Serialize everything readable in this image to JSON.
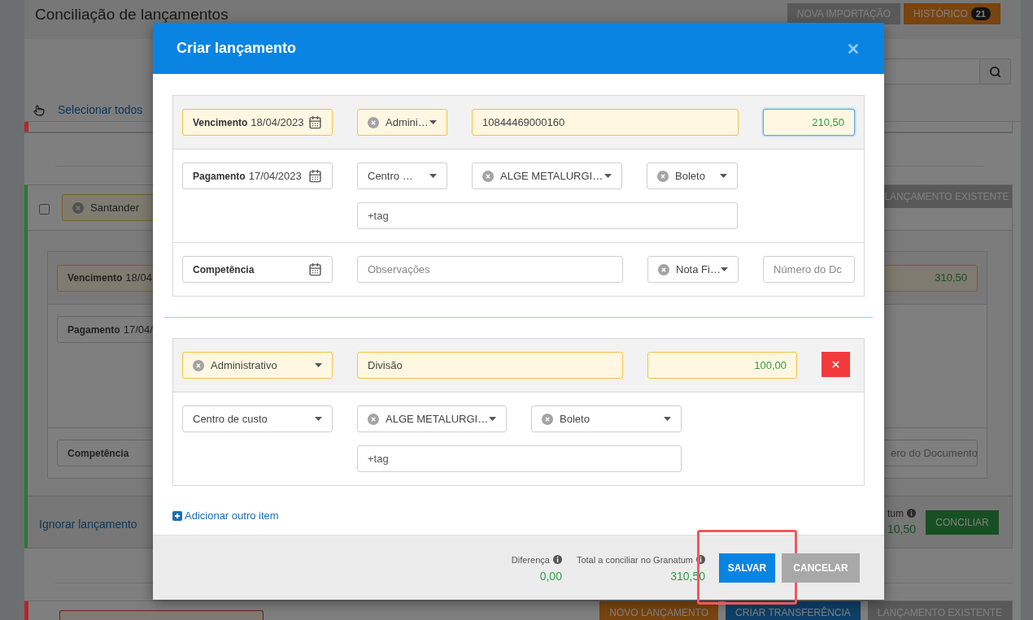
{
  "page": {
    "title": "Conciliação de lançamentos",
    "header_buttons": [
      {
        "label": "NOVA IMPORTAÇÃO",
        "kind": "plain"
      },
      {
        "label": "HISTÓRICO",
        "badge": "21",
        "kind": "accent"
      }
    ],
    "select_all": "Selecionar todos"
  },
  "entry_above": {
    "color": "#b3262a"
  },
  "entry": {
    "color": "#237a35",
    "checked": false,
    "account": "Santander",
    "action": "LANÇAMENTO EXISTENTE",
    "due": {
      "label": "Vencimento",
      "value": "18/04"
    },
    "amount": "310,50",
    "payment": {
      "label": "Pagamento",
      "value": "17/04/"
    },
    "competence": {
      "label": "Competência"
    },
    "document_placeholder": "ero do Documento",
    "ignore": "Ignorar lançamento",
    "total_label": "tum",
    "total_value": "10,50",
    "reconcile": "CONCILIAR"
  },
  "entry_below": {
    "color": "#b3262a",
    "buttons": [
      {
        "label": "NOVO LANÇAMENTO",
        "kind": "orange"
      },
      {
        "label": "CRIAR TRANSFERÊNCIA",
        "kind": "blue"
      },
      {
        "label": "LANÇAMENTO EXISTENTE",
        "kind": "gray"
      }
    ]
  },
  "dialog": {
    "title": "Criar lançamento",
    "sections": [
      {
        "rows": [
          {
            "fields": [
              {
                "kind": "date",
                "label": "Vencimento",
                "value": "18/04/2023",
                "highlighted": true
              },
              {
                "kind": "select",
                "value": "Admini…",
                "clearable": true,
                "highlighted": true
              },
              {
                "kind": "text",
                "value": "10844469000160",
                "highlighted": true
              },
              {
                "kind": "amount",
                "value": "210,50",
                "highlighted": true,
                "focused": true
              }
            ]
          },
          {
            "fields": [
              {
                "kind": "date",
                "label": "Pagamento",
                "value": "17/04/2023",
                "highlighted": false
              },
              {
                "kind": "select",
                "value": "Centro …",
                "clearable": false,
                "highlighted": false
              },
              {
                "kind": "select",
                "value": "ALGE METALURGI…",
                "clearable": true,
                "highlighted": false
              },
              {
                "kind": "select",
                "value": "Boleto",
                "clearable": true,
                "highlighted": false
              }
            ],
            "tag": {
              "placeholder": "+tag"
            }
          },
          {
            "fields": [
              {
                "kind": "date",
                "label": "Competência",
                "highlighted": false
              },
              {
                "kind": "text",
                "placeholder": "Observações",
                "highlighted": false
              },
              {
                "kind": "select",
                "value": "Nota Fi…",
                "clearable": true,
                "highlighted": false
              },
              {
                "kind": "text",
                "placeholder": "Número do Dc",
                "highlighted": false
              }
            ]
          }
        ]
      },
      {
        "rows": [
          {
            "fields": [
              {
                "kind": "select",
                "value": "Administrativo",
                "clearable": true,
                "highlighted": true
              },
              {
                "kind": "text",
                "value": "Divisão",
                "highlighted": true
              },
              {
                "kind": "amount",
                "value": "100,00",
                "highlighted": true,
                "focused": false
              },
              {
                "kind": "remove"
              }
            ]
          },
          {
            "fields": [
              {
                "kind": "select",
                "value": "Centro de custo",
                "clearable": false,
                "highlighted": false
              },
              {
                "kind": "select",
                "value": "ALGE METALURGI…",
                "clearable": true,
                "highlighted": false
              },
              {
                "kind": "select",
                "value": "Boleto",
                "clearable": true,
                "highlighted": false
              }
            ],
            "tag": {
              "placeholder": "+tag"
            }
          }
        ]
      }
    ],
    "add_item": "Adicionar outro item",
    "totals": [
      {
        "label": "Diferença",
        "value": "0,00"
      },
      {
        "label": "Total a conciliar no Granatum",
        "value": "310,50"
      }
    ],
    "buttons": [
      {
        "label": "SALVAR",
        "kind": "primary",
        "highlighted": true
      },
      {
        "label": "CANCELAR",
        "kind": "secondary",
        "highlighted": false
      }
    ]
  }
}
